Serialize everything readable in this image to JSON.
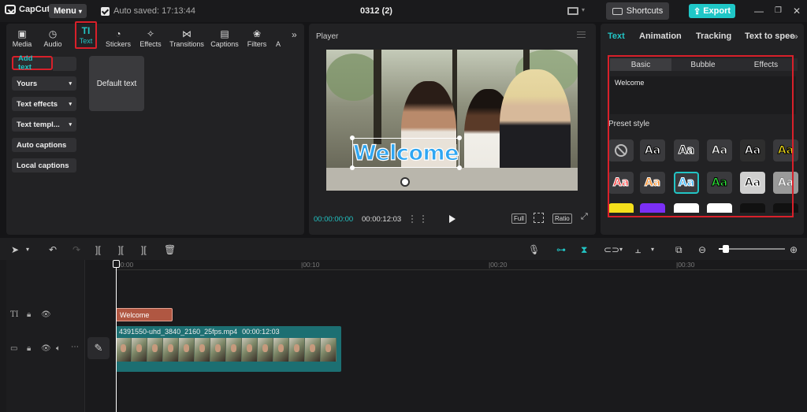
{
  "app": {
    "name": "CapCut",
    "menu_label": "Menu",
    "autosave": "Auto saved: 17:13:44",
    "project_title": "0312 (2)",
    "shortcuts_label": "Shortcuts",
    "export_label": "Export"
  },
  "left_panel": {
    "tabs": [
      {
        "label": "Media",
        "icon": "media-icon"
      },
      {
        "label": "Audio",
        "icon": "audio-icon"
      },
      {
        "label": "Text",
        "icon": "text-icon",
        "active": true
      },
      {
        "label": "Stickers",
        "icon": "stickers-icon"
      },
      {
        "label": "Effects",
        "icon": "effects-icon"
      },
      {
        "label": "Transitions",
        "icon": "transitions-icon"
      },
      {
        "label": "Captions",
        "icon": "captions-icon"
      },
      {
        "label": "Filters",
        "icon": "filters-icon"
      },
      {
        "label": "A",
        "icon": "more-icon"
      }
    ],
    "side_items": [
      {
        "label": "Add text",
        "active": true
      },
      {
        "label": "Yours"
      },
      {
        "label": "Text effects"
      },
      {
        "label": "Text templ..."
      },
      {
        "label": "Auto captions"
      },
      {
        "label": "Local captions"
      }
    ],
    "default_text_label": "Default text"
  },
  "player": {
    "label": "Player",
    "overlay_text": "Welcome",
    "current_time": "00:00:00:00",
    "total_time": "00:00:12:03",
    "full_label": "Full",
    "ratio_label": "Ratio"
  },
  "right_panel": {
    "tabs": [
      "Text",
      "Animation",
      "Tracking",
      "Text to speech"
    ],
    "active_tab": "Text",
    "subtabs": [
      "Basic",
      "Bubble",
      "Effects"
    ],
    "active_subtab": "Basic",
    "text_value": "Welcome",
    "preset_label": "Preset style",
    "preset_sample": "Aa",
    "preset_styles": [
      {
        "kind": "none"
      },
      {
        "color": "#ffffff",
        "stroke": "#000000"
      },
      {
        "color": "#000000",
        "stroke": "#ffffff"
      },
      {
        "color": "#ffffff",
        "stroke": "#222222"
      },
      {
        "color": "#ffffff",
        "stroke": "#000000",
        "bg": "#2e2e2e"
      },
      {
        "color": "#f5e01b",
        "stroke": "#000000"
      },
      {
        "color": "#ff3b3b",
        "stroke": "#ffffff"
      },
      {
        "color": "#ff8a1f",
        "stroke": "#ffffff"
      },
      {
        "color": "#33b4ff",
        "stroke": "#ffffff",
        "selected": true
      },
      {
        "color": "#2ee83a",
        "stroke": "#000000"
      },
      {
        "color": "#000000",
        "stroke": "#ffffff",
        "bg": "#cfcfcf"
      },
      {
        "color": "#ffffff",
        "stroke": "#888888",
        "bg": "#9a9a9a"
      }
    ],
    "partial_row_colors": [
      "#f5e01b",
      "#7b2ff7",
      "#ffffff",
      "#ffffff",
      "#111111",
      "#111111"
    ]
  },
  "timeline": {
    "ruler_labels": [
      "00:00",
      "|00:10",
      "|00:20",
      "|00:30"
    ],
    "text_clip_label": "Welcome",
    "video_clip_name": "4391550-uhd_3840_2160_25fps.mp4",
    "video_clip_duration": "00:00:12:03"
  },
  "colors": {
    "accent": "#22c4c4",
    "highlight_box": "#d8202a",
    "export_bg": "#1fc7c7",
    "text_clip": "#b05742",
    "video_clip": "#1c6f72"
  }
}
